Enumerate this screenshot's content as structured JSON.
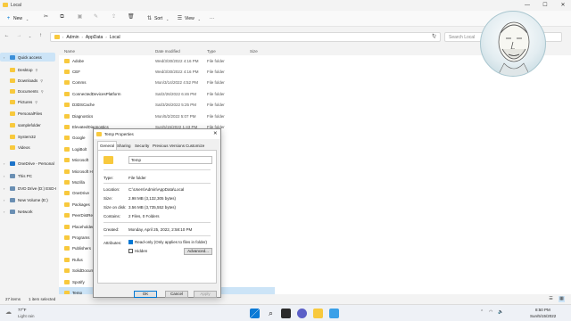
{
  "window": {
    "title": "Local",
    "minimize": "—",
    "maximize": "☐",
    "close": "✕"
  },
  "toolbar": {
    "new_label": "New",
    "sort_label": "Sort",
    "view_label": "View",
    "more_label": "···"
  },
  "breadcrumb": [
    "Admin",
    "AppData",
    "Local"
  ],
  "search": {
    "placeholder": "Search Local"
  },
  "columns": [
    "Name",
    "Date modified",
    "Type",
    "Size"
  ],
  "nav": [
    {
      "label": "Quick access",
      "icon": "star-icon",
      "selected": true
    },
    {
      "label": "Desktop",
      "icon": "desktop-icon",
      "pinned": true
    },
    {
      "label": "Downloads",
      "icon": "download-icon",
      "pinned": true
    },
    {
      "label": "Documents",
      "icon": "document-icon",
      "pinned": true
    },
    {
      "label": "Pictures",
      "icon": "picture-icon",
      "pinned": true
    },
    {
      "label": "PersonalFiles",
      "icon": "folder-icon"
    },
    {
      "label": "samplefolder",
      "icon": "folder-icon"
    },
    {
      "label": "System32",
      "icon": "folder-icon"
    },
    {
      "label": "Videos",
      "icon": "video-icon"
    },
    {
      "label": "OneDrive - Personal",
      "icon": "cloud-icon"
    },
    {
      "label": "This PC",
      "icon": "pc-icon"
    },
    {
      "label": "DVD Drive (D:) ESD-I",
      "icon": "dvd-icon"
    },
    {
      "label": "New Volume (E:)",
      "icon": "drive-icon"
    },
    {
      "label": "Network",
      "icon": "network-icon"
    }
  ],
  "files": [
    {
      "name": "Adobe",
      "date": "Wed/3/30/2022 4:16 PM",
      "type": "File folder"
    },
    {
      "name": "CEF",
      "date": "Wed/3/30/2022 4:16 PM",
      "type": "File folder"
    },
    {
      "name": "Comms",
      "date": "Mon/3/14/2022 4:52 PM",
      "type": "File folder"
    },
    {
      "name": "ConnectedDevicesPlatform",
      "date": "Sat/2/26/2022 6:46 PM",
      "type": "File folder"
    },
    {
      "name": "D3DSCache",
      "date": "Sat/3/26/2022 5:25 PM",
      "type": "File folder"
    },
    {
      "name": "Diagnostics",
      "date": "Mon/5/2/2022 5:07 PM",
      "type": "File folder"
    },
    {
      "name": "ElevatedDiagnostics",
      "date": "Sun/5/15/2022 1:43 PM",
      "type": "File folder"
    },
    {
      "name": "Google",
      "date": "",
      "type": ""
    },
    {
      "name": "LogiBolt",
      "date": "",
      "type": ""
    },
    {
      "name": "Microsoft",
      "date": "",
      "type": ""
    },
    {
      "name": "Microsoft H",
      "date": "",
      "type": ""
    },
    {
      "name": "Mozilla",
      "date": "",
      "type": ""
    },
    {
      "name": "OneDrive",
      "date": "",
      "type": ""
    },
    {
      "name": "Packages",
      "date": "",
      "type": ""
    },
    {
      "name": "PeerDistRep",
      "date": "",
      "type": ""
    },
    {
      "name": "Placeholder",
      "date": "",
      "type": ""
    },
    {
      "name": "Programs",
      "date": "",
      "type": ""
    },
    {
      "name": "Publishers",
      "date": "",
      "type": ""
    },
    {
      "name": "Rufus",
      "date": "",
      "type": ""
    },
    {
      "name": "SolidDocum",
      "date": "",
      "type": ""
    },
    {
      "name": "Spotify",
      "date": "",
      "type": ""
    },
    {
      "name": "Temp",
      "date": "",
      "type": "",
      "selected": true
    }
  ],
  "status": {
    "items": "27 items",
    "selected": "1 item selected"
  },
  "weather": {
    "temp": "77°F",
    "condition": "Light rain"
  },
  "clock": {
    "time": "8:50 PM",
    "date": "Sun/5/15/2022"
  },
  "dialog": {
    "title": "Temp Properties",
    "close": "✕",
    "tabs": [
      "General",
      "Sharing",
      "Security",
      "Previous Versions",
      "Customize"
    ],
    "folder_name": "Temp",
    "props": [
      {
        "label": "Type:",
        "value": "File folder"
      },
      {
        "label": "Location:",
        "value": "C:\\Users\\Admin\\AppData\\Local"
      },
      {
        "label": "Size:",
        "value": "2.98 MB (3,132,305 bytes)"
      },
      {
        "label": "Size on disk:",
        "value": "3.56 MB (3,735,552 bytes)"
      },
      {
        "label": "Contains:",
        "value": "2 Files, 0 Folders"
      }
    ],
    "created_label": "Created:",
    "created_value": "Monday, April 25, 2022, 2:58:10 PM",
    "attributes_label": "Attributes:",
    "readonly_label": "Read-only (Only applies to files in folder)",
    "hidden_label": "Hidden",
    "advanced_label": "Advanced...",
    "ok_label": "OK",
    "cancel_label": "Cancel",
    "apply_label": "Apply"
  },
  "colors": {
    "accent": "#0078d4",
    "folder": "#f8c93d",
    "selection": "#cce4f7"
  }
}
